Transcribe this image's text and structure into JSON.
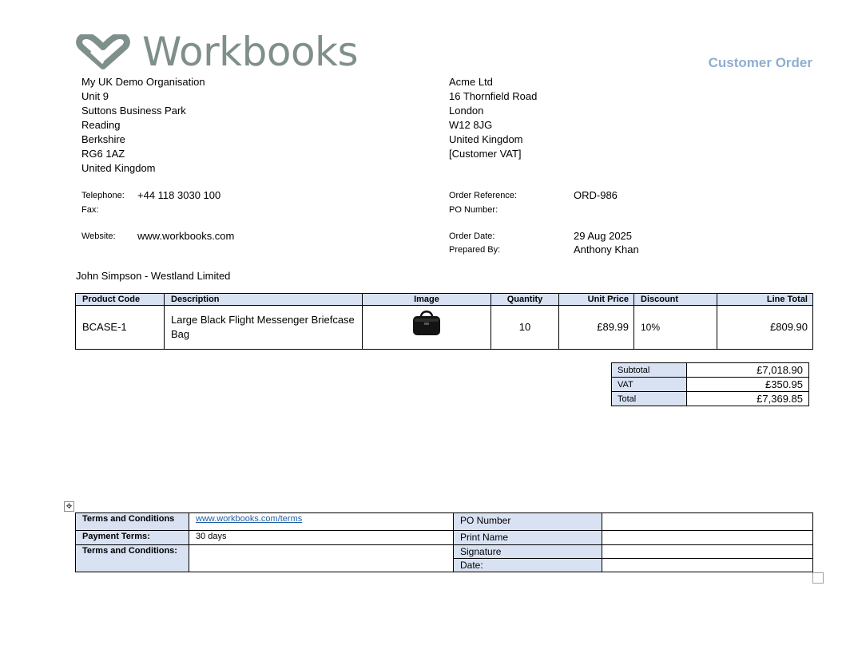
{
  "header": {
    "logo_text": "Workbooks",
    "title": "Customer Order",
    "title_color": "#8eaed1",
    "logo_color": "#7f8f8b"
  },
  "supplier": {
    "lines": [
      "My UK Demo Organisation",
      "Unit 9",
      "Suttons Business Park",
      "Reading",
      "Berkshire",
      "RG6 1AZ",
      "United Kingdom"
    ],
    "telephone_label": "Telephone:",
    "telephone": "+44 118 3030 100",
    "fax_label": "Fax:",
    "fax": "",
    "website_label": "Website:",
    "website": "www.workbooks.com"
  },
  "customer": {
    "lines": [
      "Acme Ltd",
      "16 Thornfield Road",
      "London",
      "W12 8JG",
      "United Kingdom",
      "[Customer VAT]"
    ]
  },
  "order": {
    "reference_label": "Order Reference:",
    "reference": "ORD-986",
    "po_label": "PO Number:",
    "po": "",
    "date_label": "Order Date:",
    "date": "29 Aug 2025",
    "prepared_label": "Prepared By:",
    "prepared_by": "Anthony Khan"
  },
  "contact_line": "John Simpson - Westland Limited",
  "items": {
    "headers": {
      "code": "Product Code",
      "description": "Description",
      "image": "Image",
      "quantity": "Quantity",
      "unit_price": "Unit Price",
      "discount": "Discount",
      "line_total": "Line Total"
    },
    "header_bg": "#d9e2f3",
    "rows": [
      {
        "code": "BCASE-1",
        "description": "Large Black Flight Messenger Briefcase Bag",
        "image_icon": "briefcase-bag-icon",
        "quantity": "10",
        "unit_price": "£89.99",
        "discount": "10%",
        "line_total": "£809.90"
      }
    ]
  },
  "totals": {
    "subtotal_label": "Subtotal",
    "subtotal": "£7,018.90",
    "vat_label": "VAT",
    "vat": "£350.95",
    "total_label": "Total",
    "total": "£7,369.85"
  },
  "terms": {
    "terms_label": "Terms and Conditions",
    "terms_link": "www.workbooks.com/terms",
    "link_color": "#1f5fa6",
    "payment_label": "Payment Terms:",
    "payment_value": "30 days",
    "terms_label2": "Terms and Conditions:",
    "terms_value2": "",
    "po_number_label": "PO Number",
    "print_name_label": "Print Name",
    "signature_label": "Signature",
    "date_label": "Date:"
  }
}
